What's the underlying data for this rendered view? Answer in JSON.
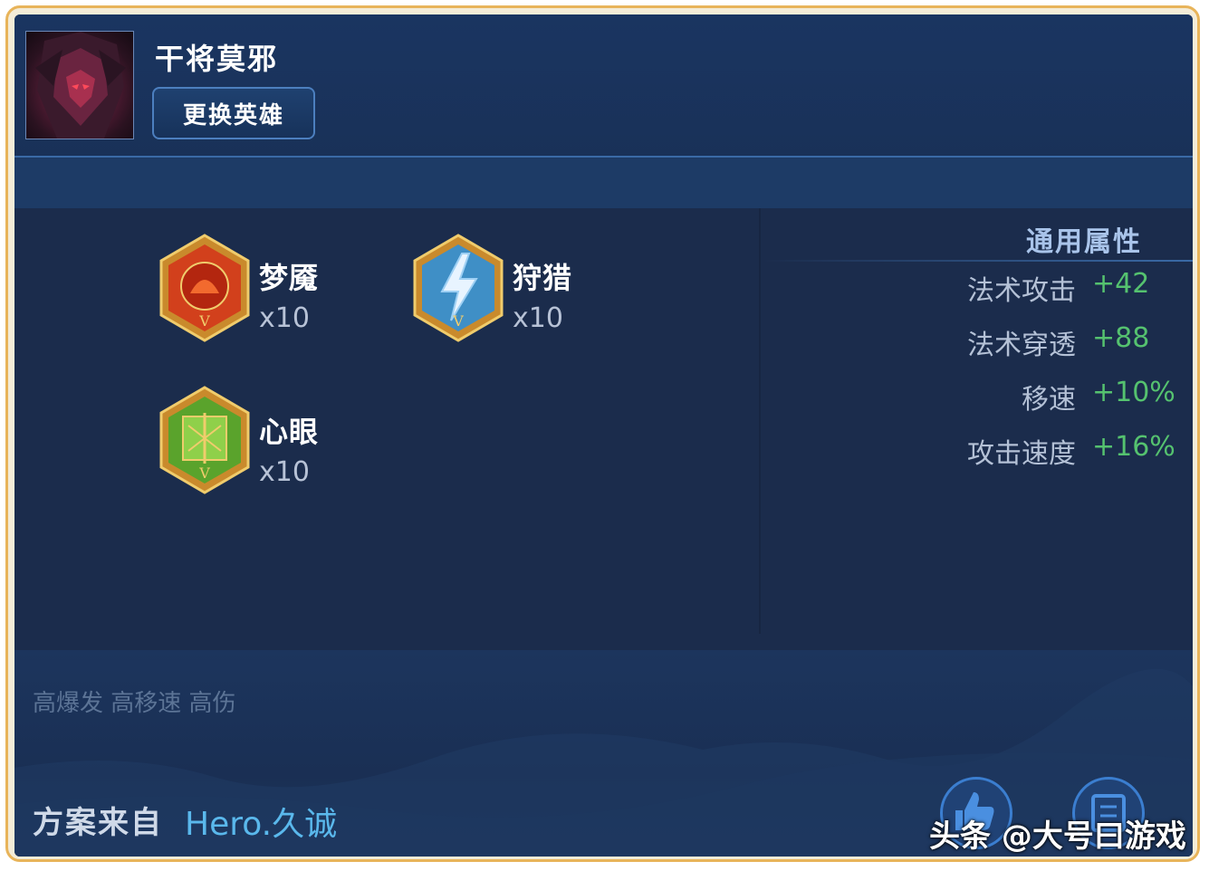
{
  "hero": {
    "name": "干将莫邪",
    "change_button": "更换英雄"
  },
  "runes": [
    {
      "name": "梦魇",
      "count": "x10",
      "color": "#d2401c"
    },
    {
      "name": "狩猎",
      "count": "x10",
      "color": "#3f8fc6"
    },
    {
      "name": "心眼",
      "count": "x10",
      "color": "#5aa32c"
    }
  ],
  "attributes": {
    "title": "通用属性",
    "items": [
      {
        "label": "法术攻击",
        "value": "+42"
      },
      {
        "label": "法术穿透",
        "value": "+88"
      },
      {
        "label": "移速",
        "value": "+10%"
      },
      {
        "label": "攻击速度",
        "value": "+16%"
      }
    ]
  },
  "tags": "高爆发 高移速 高伤",
  "source": {
    "label": "方案来自",
    "author": "Hero.久诚"
  },
  "actions": {
    "like_icon": "thumbs-up-icon",
    "share_icon": "share-icon"
  },
  "watermark": "头条 @大号曰游戏",
  "colors": {
    "frame_border": "#e8b45a",
    "panel_bg": "#1b2c4c",
    "value_green": "#55c26f",
    "author_blue": "#5ab8ec"
  }
}
